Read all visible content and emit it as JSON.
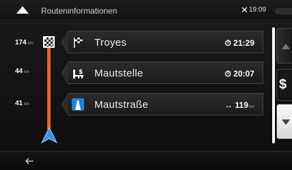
{
  "status_bar": {
    "title": "Routeninformationen",
    "time": "19:09",
    "icons": [
      "navigate-up-icon",
      "satellite-icon",
      "battery-pill-icon"
    ]
  },
  "route": {
    "distances": [
      {
        "value": "174",
        "unit": "km"
      },
      {
        "value": "44",
        "unit": "km"
      },
      {
        "value": "41",
        "unit": "km"
      }
    ],
    "colors": {
      "route_line": "#e9612c",
      "position_arrow": "#3c8fe8"
    }
  },
  "items": [
    {
      "name": "Troyes",
      "icon": "checkered-flag-icon",
      "meta_icon": "clock-icon",
      "meta": "21:29",
      "meta_unit": ""
    },
    {
      "name": "Mautstelle",
      "icon": "toll-booth-icon",
      "meta_icon": "clock-icon",
      "meta": "20:07",
      "meta_unit": ""
    },
    {
      "name": "Mautstraße",
      "icon": "toll-road-icon",
      "meta_icon": "distance-icon",
      "meta": "119",
      "meta_unit": "km"
    }
  ],
  "side_buttons": {
    "scroll_up": "scroll-up",
    "toll_label": "$",
    "scroll_down": "scroll-down"
  },
  "footer": {
    "back": "back-arrow-icon"
  }
}
